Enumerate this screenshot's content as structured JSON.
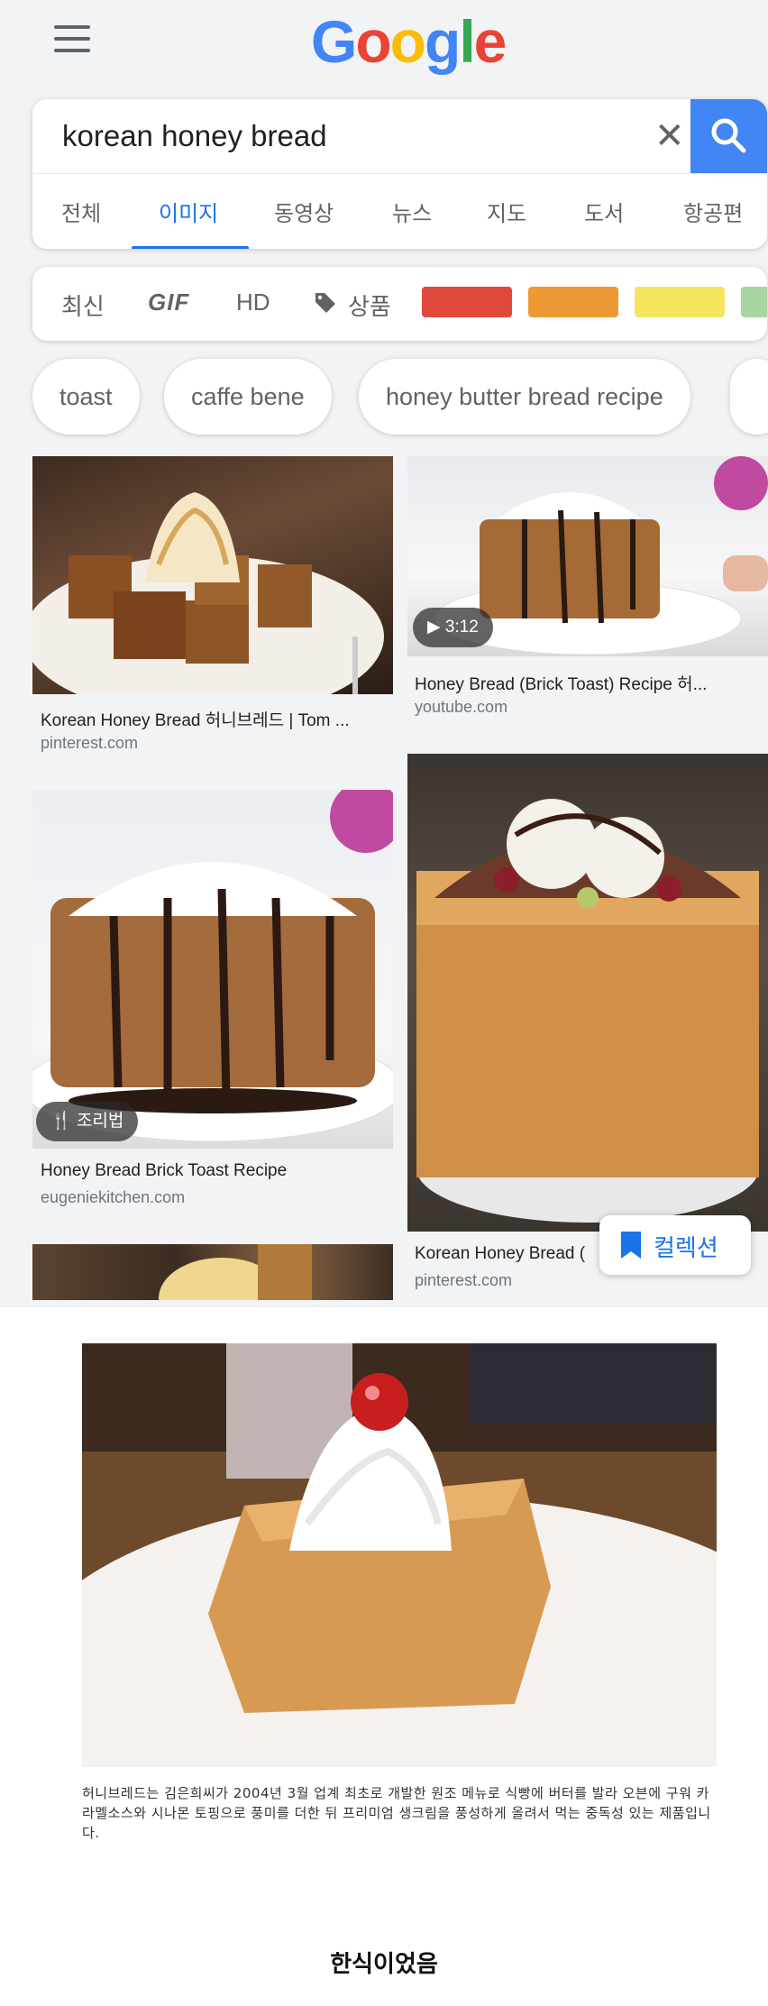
{
  "header": {
    "logo_letters": [
      "G",
      "o",
      "o",
      "g",
      "l",
      "e"
    ]
  },
  "search": {
    "query": "korean honey bread",
    "clear_glyph": "✕"
  },
  "tabs": [
    "전체",
    "이미지",
    "동영상",
    "뉴스",
    "지도",
    "도서",
    "항공편"
  ],
  "active_tab": "이미지",
  "filters": {
    "latest": "최신",
    "gif": "GIF",
    "hd": "HD",
    "products": "상품",
    "colors": [
      "#e0483b",
      "#ee9a34",
      "#f7e45e",
      "#a8d5a2"
    ]
  },
  "chips": [
    "toast",
    "caffe bene",
    "honey butter bread recipe"
  ],
  "results": [
    {
      "title": "Korean Honey Bread 허니브레드 | Tom ...",
      "site": "pinterest.com"
    },
    {
      "title": "Honey Bread (Brick Toast) Recipe 허...",
      "site": "youtube.com",
      "duration": "3:12"
    },
    {
      "title": "Honey Bread Brick Toast Recipe",
      "site": "eugeniekitchen.com",
      "badge": "조리법"
    },
    {
      "title": "Korean Honey Bread (",
      "site": "pinterest.com"
    }
  ],
  "collection_button": "컬렉션",
  "article": {
    "caption": "허니브레드는 김은희씨가 2004년 3월 업계 최초로 개발한 원조 메뉴로 식빵에 버터를 발라 오븐에 구워 카라멜소스와 시나몬 토핑으로 풍미를 더한 뒤 프리미엄 생크림을 풍성하게 올려서 먹는 중독성 있는 제품입니다.",
    "footer": "한식이었음"
  },
  "icons": [
    "menu-icon",
    "close-icon",
    "search-icon",
    "tag-icon",
    "play-icon",
    "utensils-icon",
    "bookmark-icon"
  ]
}
